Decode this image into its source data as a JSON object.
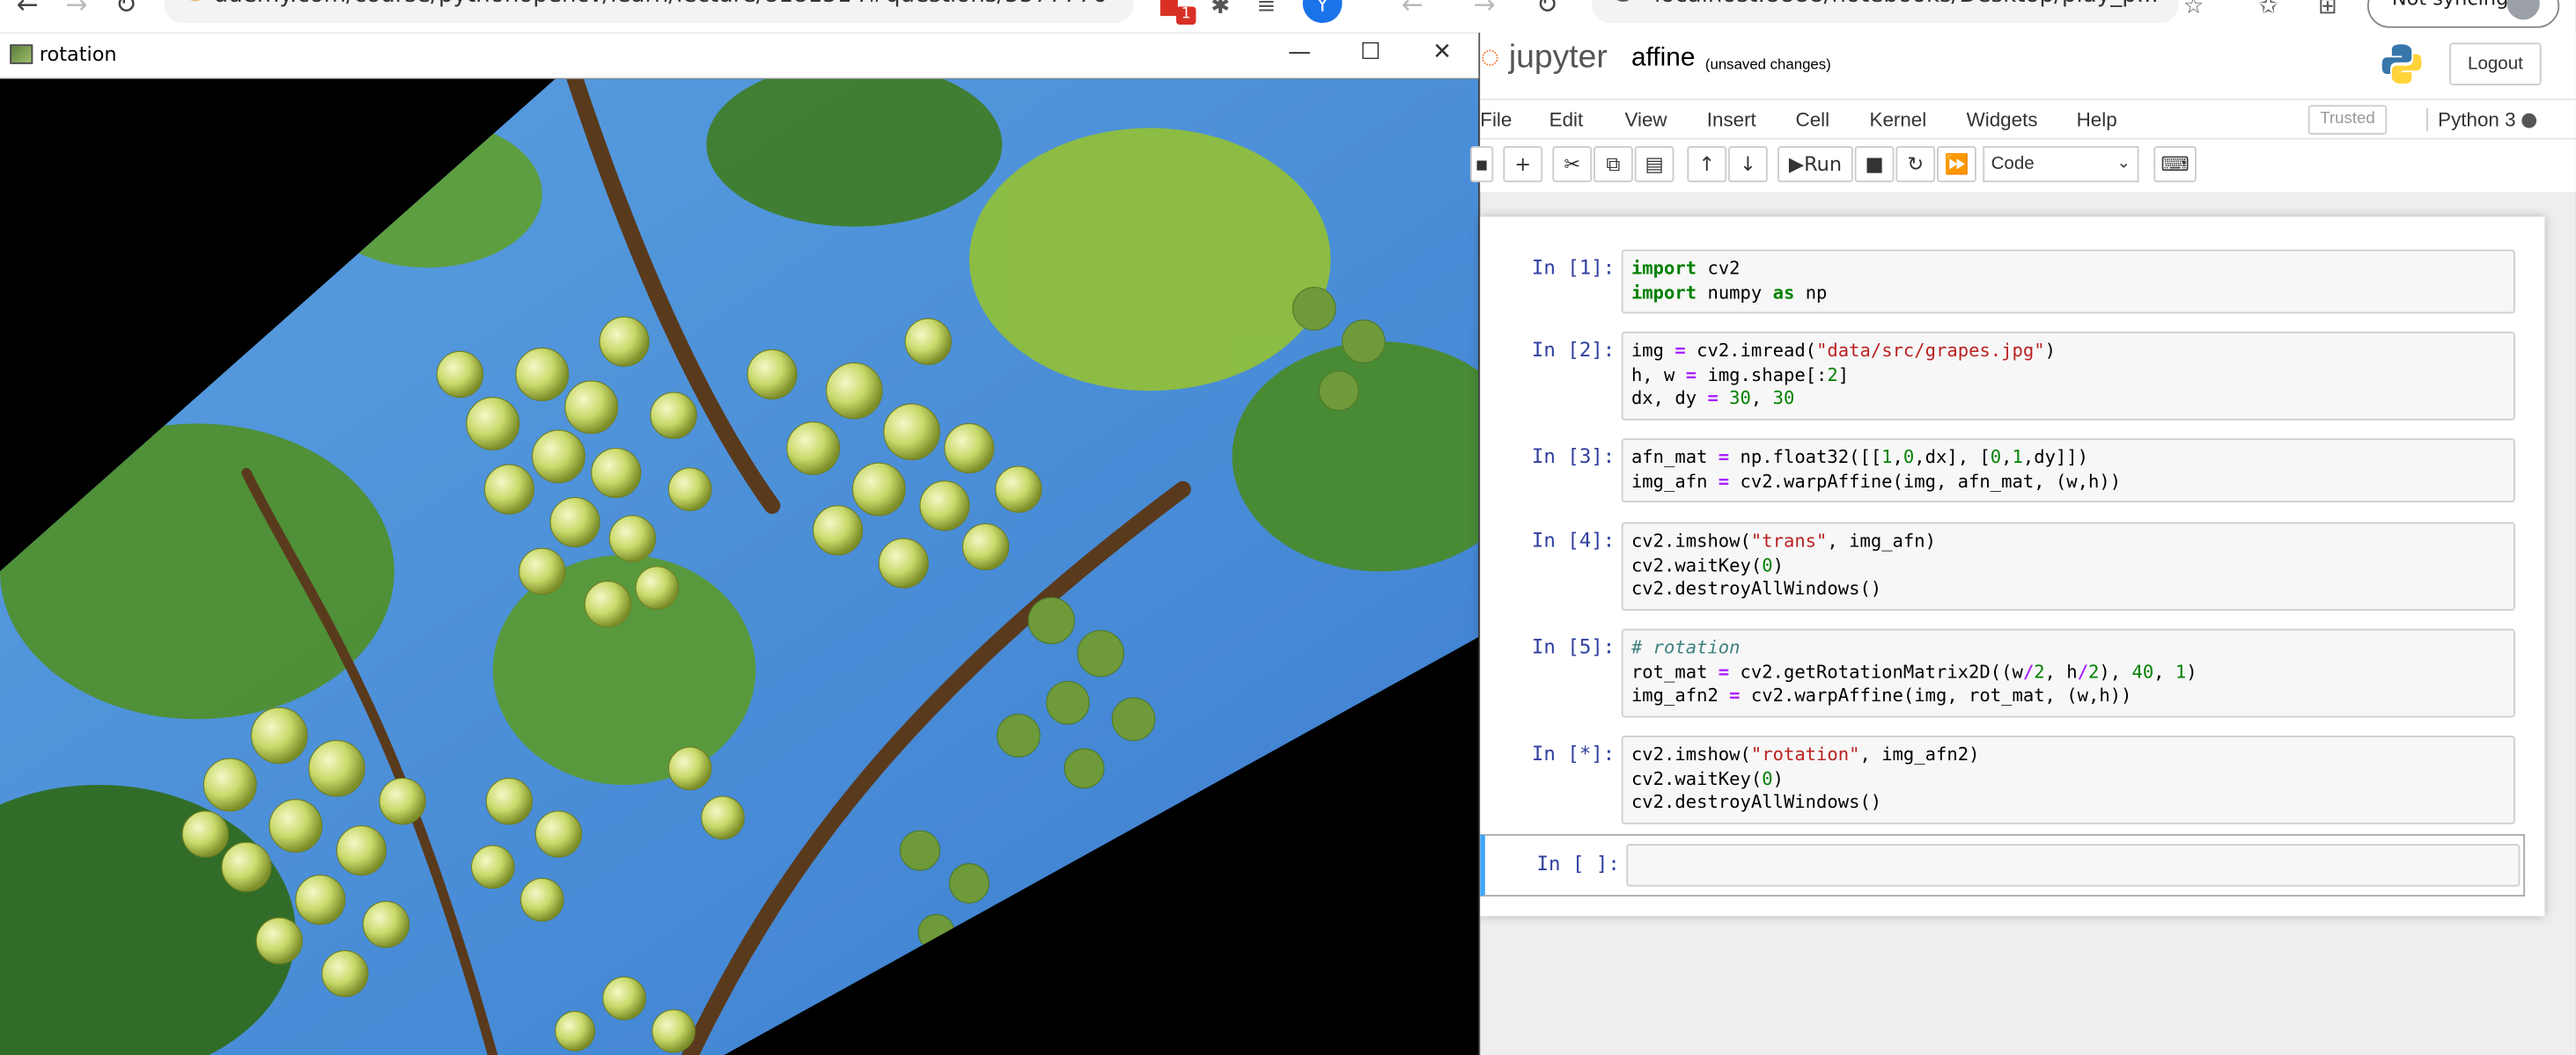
{
  "left_browser": {
    "url": "udemy.com/course/pythonopencv/learn/lecture/8181514#questions/5577776",
    "extension_badge": "1",
    "avatar_letter": "Y"
  },
  "right_browser": {
    "url": "localhost:8888/notebooks/Desktop/play_p...",
    "sync_label": "Not syncing"
  },
  "image_window": {
    "title": "rotation",
    "minimize": "—",
    "maximize": "☐",
    "close": "✕"
  },
  "jupyter": {
    "logo_text": "jupyter",
    "notebook_name": "affine",
    "save_status": "(unsaved changes)",
    "logout_label": "Logout",
    "menu": [
      "File",
      "Edit",
      "View",
      "Insert",
      "Cell",
      "Kernel",
      "Widgets",
      "Help"
    ],
    "trusted_label": "Trusted",
    "kernel_name": "Python 3",
    "run_label": "Run",
    "cell_type": "Code",
    "cells": [
      {
        "prompt": "In [1]:"
      },
      {
        "prompt": "In [2]:"
      },
      {
        "prompt": "In [3]:"
      },
      {
        "prompt": "In [4]:"
      },
      {
        "prompt": "In [5]:"
      },
      {
        "prompt": "In [*]:"
      },
      {
        "prompt": "In [ ]:"
      }
    ],
    "code": {
      "c1_l1_kw": "import",
      "c1_l1_rest": " cv2",
      "c1_l2_kw": "import",
      "c1_l2_mid": " numpy ",
      "c1_l2_as": "as",
      "c1_l2_rest": " np",
      "c2_l1_a": "img ",
      "c2_l1_op": "=",
      "c2_l1_b": " cv2.imread(",
      "c2_l1_str": "\"data/src/grapes.jpg\"",
      "c2_l1_c": ")",
      "c2_l2_a": "h, w ",
      "c2_l2_op": "=",
      "c2_l2_b": " img.shape[:",
      "c2_l2_num": "2",
      "c2_l2_c": "]",
      "c2_l3_a": "dx, dy ",
      "c2_l3_op": "=",
      "c2_l3_sp": " ",
      "c2_l3_n1": "30",
      "c2_l3_comma": ", ",
      "c2_l3_n2": "30",
      "c3_l1_a": "afn_mat ",
      "c3_l1_op": "=",
      "c3_l1_b": " np.float32([[",
      "c3_l1_n1": "1",
      "c3_l1_c": ",",
      "c3_l1_n2": "0",
      "c3_l1_d": ",dx], [",
      "c3_l1_n3": "0",
      "c3_l1_e": ",",
      "c3_l1_n4": "1",
      "c3_l1_f": ",dy]])",
      "c3_l2_a": "img_afn ",
      "c3_l2_op": "=",
      "c3_l2_b": " cv2.warpAffine(img, afn_mat, (w,h))",
      "c4_l1_a": "cv2.imshow(",
      "c4_l1_str": "\"trans\"",
      "c4_l1_b": ", img_afn)",
      "c4_l2_a": "cv2.waitKey(",
      "c4_l2_num": "0",
      "c4_l2_b": ")",
      "c4_l3": "cv2.destroyAllWindows()",
      "c5_l1": "# rotation",
      "c5_l2_a": "rot_mat ",
      "c5_l2_op": "=",
      "c5_l2_b": " cv2.getRotationMatrix2D((w",
      "c5_l2_op2": "/",
      "c5_l2_n1": "2",
      "c5_l2_c": ", h",
      "c5_l2_op3": "/",
      "c5_l2_n2": "2",
      "c5_l2_d": "), ",
      "c5_l2_n3": "40",
      "c5_l2_e": ", ",
      "c5_l2_n4": "1",
      "c5_l2_f": ")",
      "c5_l3_a": "img_afn2 ",
      "c5_l3_op": "=",
      "c5_l3_b": " cv2.warpAffine(img, rot_mat, (w,h))",
      "c6_l1_a": "cv2.imshow(",
      "c6_l1_str": "\"rotation\"",
      "c6_l1_b": ", img_afn2)",
      "c6_l2_a": "cv2.waitKey(",
      "c6_l2_num": "0",
      "c6_l2_b": ")",
      "c6_l3": "cv2.destroyAllWindows()"
    }
  },
  "colors": {
    "jupyter_orange": "#f37726",
    "prompt_blue": "#303f9f",
    "keyword_green": "#008000",
    "string_red": "#ba2121",
    "active_cell_blue": "#42a5f5"
  }
}
